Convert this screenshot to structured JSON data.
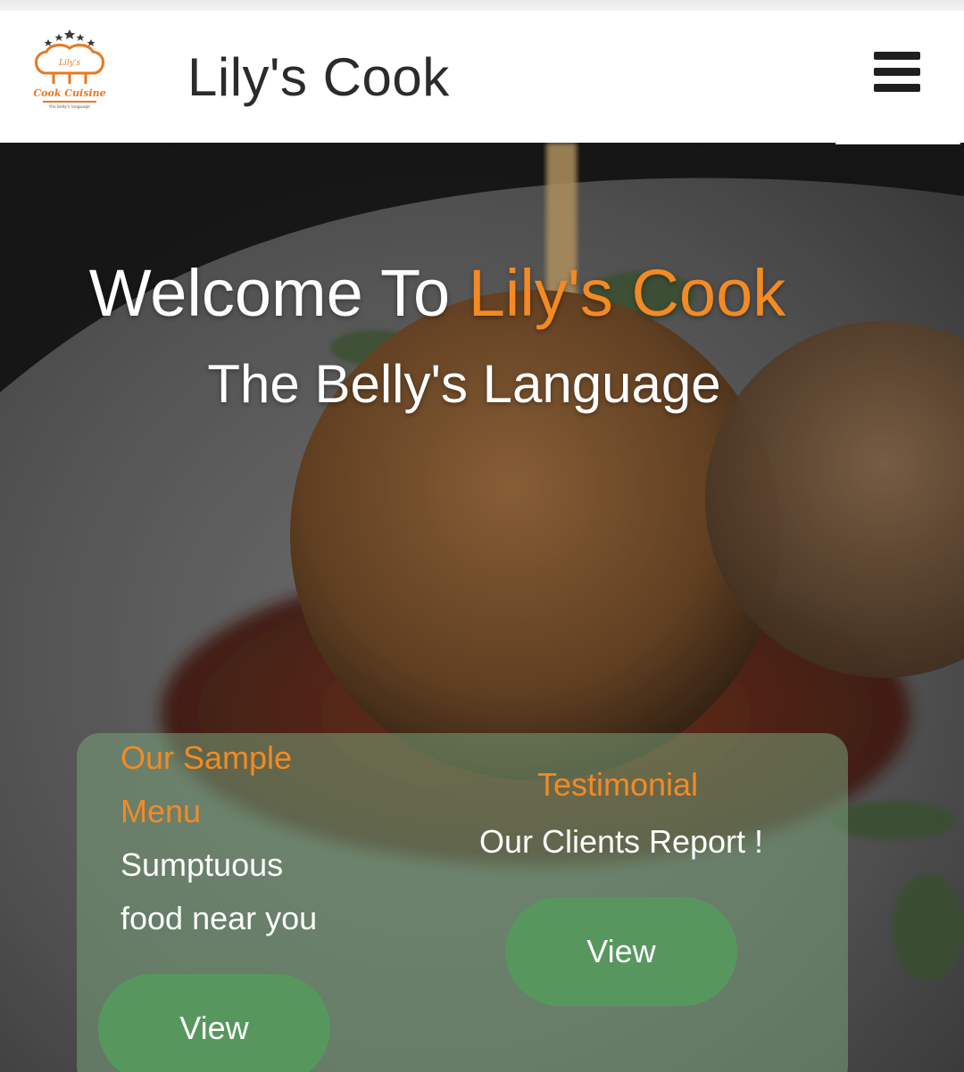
{
  "header": {
    "brand": "Lily's Cook",
    "logo": {
      "line1": "Lily's",
      "line2": "Cook Cuisine",
      "line3": "the belly's language"
    },
    "menu_icon": "hamburger-menu-icon"
  },
  "hero": {
    "welcome_prefix": "Welcome To",
    "welcome_brand": "Lily's Cook",
    "tagline": "The Belly's Language"
  },
  "cards": {
    "menu": {
      "title_line1": "Our Sample",
      "title_line2": "Menu",
      "text_line1": "Sumptuous",
      "text_line2": "food near you",
      "button": "View"
    },
    "testimonial": {
      "title": "Testimonial",
      "text": "Our Clients Report !",
      "button": "View"
    }
  },
  "colors": {
    "accent": "#f38a24",
    "button": "#57975e",
    "text_dark": "#2b2b2b"
  }
}
